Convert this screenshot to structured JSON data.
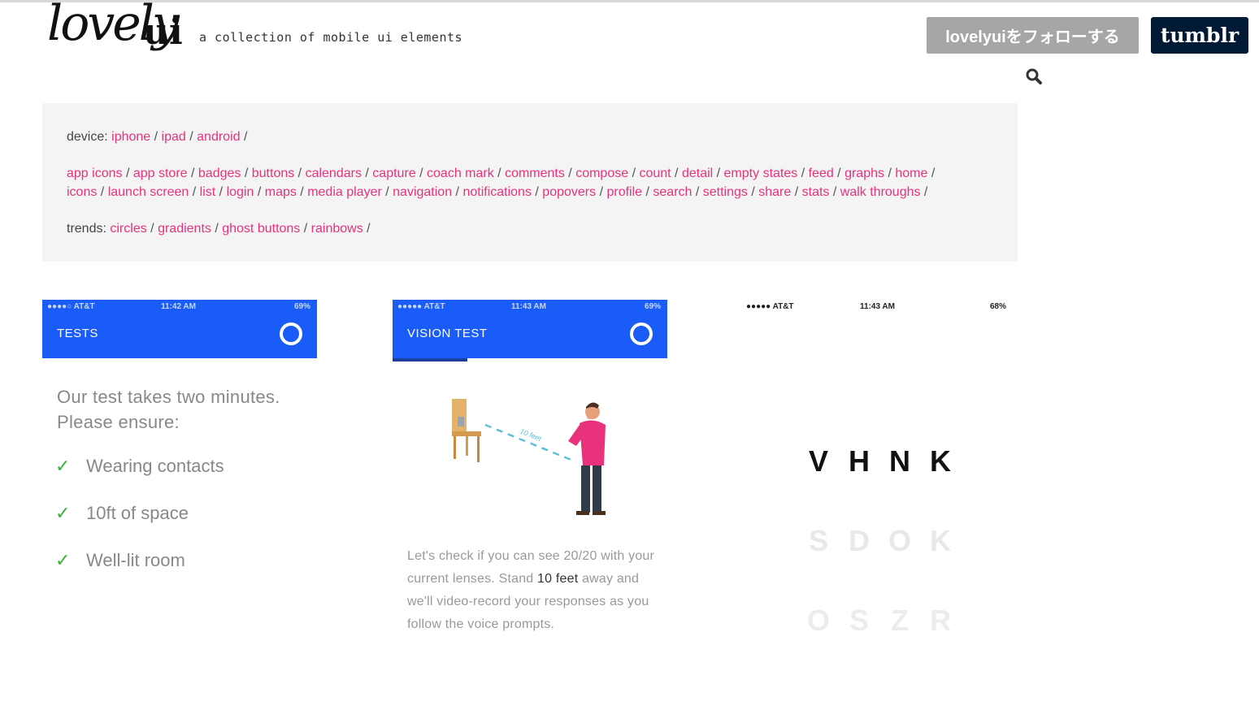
{
  "header": {
    "logo_script": "lovely",
    "logo_ui": "ui",
    "tagline": "a collection of mobile ui elements",
    "follow_button": "lovelyuiをフォローする",
    "tumblr_button": "tumblr",
    "search_icon": "search-icon"
  },
  "filters": {
    "device_label": "device:",
    "devices": [
      "iphone",
      "ipad",
      "android"
    ],
    "categories_line1": [
      "app icons",
      "app store",
      "badges",
      "buttons",
      "calendars",
      "capture",
      "coach mark",
      "comments",
      "compose",
      "count",
      "detail",
      "empty states",
      "feed",
      "graphs",
      "home"
    ],
    "categories_line2": [
      "icons",
      "launch screen",
      "list",
      "login",
      "maps",
      "media player",
      "navigation",
      "notifications",
      "popovers",
      "profile",
      "search",
      "settings",
      "share",
      "stats",
      "walk throughs"
    ],
    "trends_label": "trends:",
    "trends": [
      "circles",
      "gradients",
      "ghost buttons",
      "rainbows"
    ]
  },
  "card1": {
    "carrier": "●●●●○ AT&T",
    "time": "11:42 AM",
    "battery": "69%",
    "title": "TESTS",
    "intro_line1": "Our test takes two minutes.",
    "intro_line2": "Please ensure:",
    "checklist": [
      "Wearing contacts",
      "10ft of space",
      "Well-lit room"
    ]
  },
  "card2": {
    "carrier": "●●●●● AT&T",
    "time": "11:43 AM",
    "battery": "69%",
    "title": "VISION TEST",
    "distance_label": "10 feet",
    "text_a": "Let's check if you can see 20/20 with your current lenses. Stand ",
    "text_bold": "10 feet",
    "text_b": " away and we'll video-record your responses as you follow the voice prompts."
  },
  "card3": {
    "carrier": "●●●●● AT&T",
    "time": "11:43 AM",
    "battery": "68%",
    "row1": [
      "V",
      "H",
      "N",
      "K"
    ],
    "row2": [
      "S",
      "D",
      "O",
      "K"
    ],
    "row3": [
      "O",
      "S",
      "Z",
      "R"
    ]
  },
  "colors": {
    "link": "#e8327c",
    "appbar": "#1a5cf8",
    "check": "#3cb03c",
    "tumblr": "#001935"
  }
}
